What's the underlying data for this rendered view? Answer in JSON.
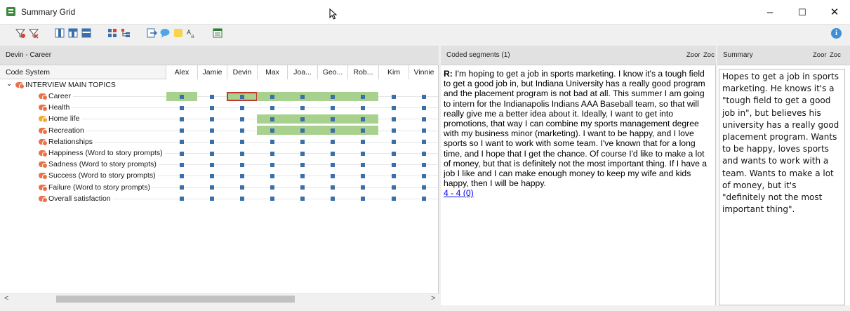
{
  "window": {
    "title": "Summary Grid",
    "minimize": "–",
    "maximize": "☐",
    "close": "✕"
  },
  "toolbar": {
    "icons": [
      "filter-icon",
      "filter-reset-icon",
      "layout-1-icon",
      "layout-2-icon",
      "layout-3-icon",
      "color-grid-icon",
      "tree-grid-icon",
      "export-icon",
      "comment-icon",
      "memo-icon",
      "font-icon",
      "table-icon"
    ],
    "info": "i"
  },
  "grid_panel": {
    "title": "Devin - Career",
    "zoom_out": "Zoor",
    "zoom_in": "Zoc",
    "code_system_header": "Code System",
    "columns": [
      "Alex",
      "Jamie",
      "Devin",
      "Max",
      "Joa...",
      "Geo...",
      "Rob...",
      "Kim",
      "Vinnie"
    ],
    "parent_code": "INTERVIEW MAIN TOPICS",
    "rows": [
      {
        "label": "Career",
        "color": "#e8734a",
        "summaries": [
          1,
          0,
          1,
          1,
          1,
          1,
          1,
          0,
          0
        ],
        "selected": 2
      },
      {
        "label": "Health",
        "color": "#e8734a",
        "summaries": [
          0,
          0,
          0,
          0,
          0,
          0,
          0,
          0,
          0
        ]
      },
      {
        "label": "Home life",
        "color": "#f2a93b",
        "summaries": [
          0,
          0,
          0,
          1,
          1,
          1,
          1,
          0,
          0
        ]
      },
      {
        "label": "Recreation",
        "color": "#e8734a",
        "summaries": [
          0,
          0,
          0,
          1,
          1,
          1,
          1,
          0,
          0
        ]
      },
      {
        "label": "Relationships",
        "color": "#e8734a",
        "summaries": [
          0,
          0,
          0,
          0,
          0,
          0,
          0,
          0,
          0
        ]
      },
      {
        "label": "Happiness (Word to story prompts)",
        "color": "#e8734a",
        "summaries": [
          0,
          0,
          0,
          0,
          0,
          0,
          0,
          0,
          0
        ]
      },
      {
        "label": "Sadness (Word to story prompts)",
        "color": "#e8734a",
        "summaries": [
          0,
          0,
          0,
          0,
          0,
          0,
          0,
          0,
          0
        ]
      },
      {
        "label": "Success (Word to story prompts)",
        "color": "#e8734a",
        "summaries": [
          0,
          0,
          0,
          0,
          0,
          0,
          0,
          0,
          0
        ]
      },
      {
        "label": "Failure (Word to story prompts)",
        "color": "#e8734a",
        "summaries": [
          0,
          0,
          0,
          0,
          0,
          0,
          0,
          0,
          0
        ]
      },
      {
        "label": "Overall satisfaction",
        "color": "#e8734a",
        "summaries": [
          0,
          0,
          0,
          0,
          0,
          0,
          0,
          0,
          0
        ]
      }
    ],
    "scroll_left": "<",
    "scroll_right": ">"
  },
  "segments_panel": {
    "title": "Coded segments (1)",
    "zoom_out": "Zoor",
    "zoom_in": "Zoc",
    "speaker": "R:",
    "text": " I'm hoping to get a job in sports marketing. I know it's a tough field to get a good job in, but Indiana University has a really good program and the placement program is not bad at all. This summer I am going to intern for the Indianapolis Indians AAA Baseball team, so that will really give me a better idea about it. Ideally, I want to get into promotions, that way I can combine my sports management degree with my business minor (marketing). I want to be happy, and I love sports so I want to work with some team. I've known that for a long time, and I hope that I get the chance. Of course I'd like to make a lot of money, but that is definitely not the most important thing. If I have a job I like and I can make enough money to keep my wife and kids happy, then I will be happy.",
    "link": "4 - 4 (0)"
  },
  "summary_panel": {
    "title": "Summary",
    "zoom_out": "Zoor",
    "zoom_in": "Zoc",
    "text": "Hopes to get a job in sports marketing. He knows it's a \"tough field to get a good job in\", but believes his university has a really good placement program. Wants to be happy, loves sports and wants to work with a team. Wants to make a lot of money, but it's \"definitely not the most important thing\"."
  },
  "colors": {
    "summary_fill": "#a9d18e",
    "dot": "#3a6fa8",
    "selection": "#c0392b"
  }
}
